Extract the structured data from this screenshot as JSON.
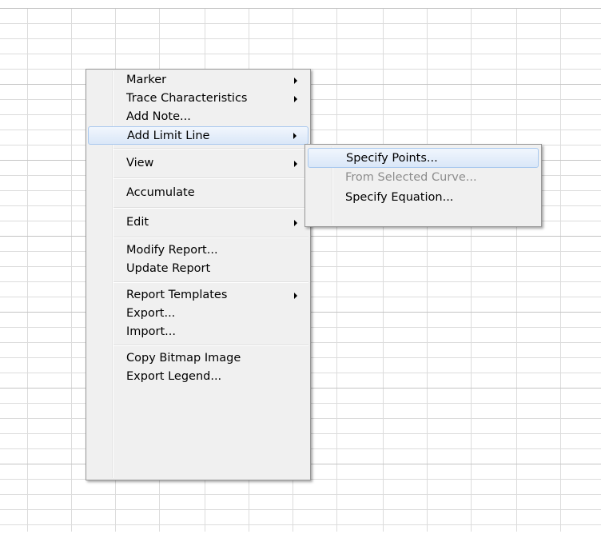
{
  "context_menu": {
    "items": [
      {
        "label": "Marker",
        "submenu": true
      },
      {
        "label": "Trace Characteristics",
        "submenu": true
      },
      {
        "label": "Add Note..."
      },
      {
        "label": "Add Limit Line",
        "submenu": true,
        "highlighted": true
      },
      {
        "label": "View",
        "submenu": true
      },
      {
        "label": "Accumulate"
      },
      {
        "label": "Edit",
        "submenu": true
      },
      {
        "label": "Modify Report..."
      },
      {
        "label": "Update Report"
      },
      {
        "label": "Report Templates",
        "submenu": true
      },
      {
        "label": "Export..."
      },
      {
        "label": "Import..."
      },
      {
        "label": "Copy Bitmap Image"
      },
      {
        "label": "Export Legend..."
      }
    ]
  },
  "limit_line_submenu": {
    "items": [
      {
        "label": "Specify Points...",
        "highlighted": true
      },
      {
        "label": "From Selected Curve...",
        "disabled": true
      },
      {
        "label": "Specify Equation..."
      }
    ]
  },
  "colors": {
    "menu_background": "#f0f0f0",
    "highlight_border": "#a8c8ee",
    "grid_line": "#dcdcdc",
    "disabled_text": "#8d8d8d"
  }
}
